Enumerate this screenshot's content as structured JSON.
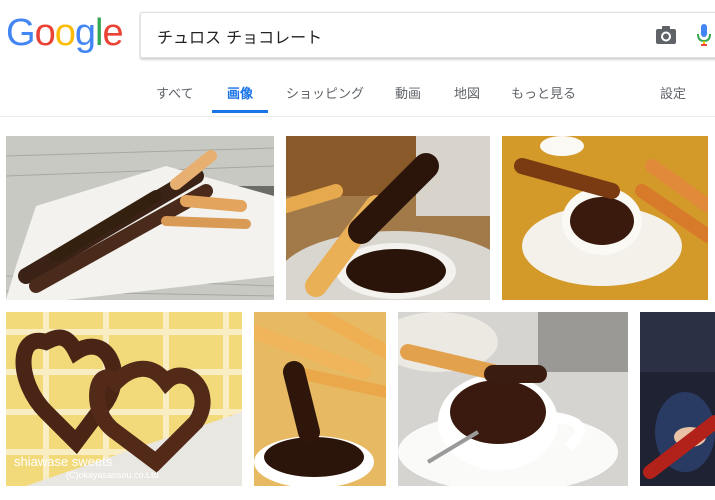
{
  "logo": {
    "letters": [
      "G",
      "o",
      "o",
      "g",
      "l",
      "e"
    ],
    "colors": [
      "#4285F4",
      "#EA4335",
      "#FBBC05",
      "#4285F4",
      "#34A853",
      "#EA4335"
    ]
  },
  "search": {
    "query": "チュロス チョコレート"
  },
  "icons": {
    "camera": "camera-icon",
    "mic": "mic-icon"
  },
  "tabs": {
    "all": "すべて",
    "images": "画像",
    "shopping": "ショッピング",
    "videos": "動画",
    "maps": "地図",
    "more": "もっと見る",
    "settings": "設定"
  },
  "images": {
    "tile5_watermark": "shiawase sweets",
    "tile5_credit": "(C)okayasansou.co.Ltd"
  },
  "colors": {
    "accent": "#1a73e8",
    "text_muted": "#5f6368"
  }
}
